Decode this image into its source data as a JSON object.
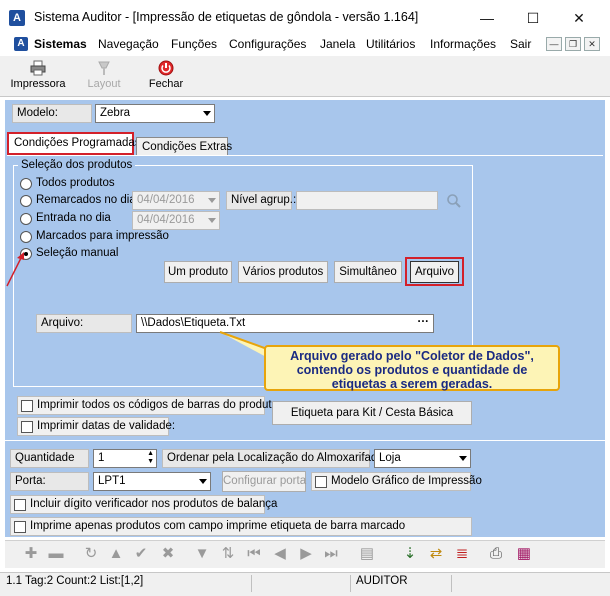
{
  "window": {
    "title": "Sistema Auditor - [Impressão de etiquetas de gôndola - versão 1.164]",
    "app_icon_letter": "A",
    "minimize": "—",
    "maximize": "☐",
    "close": "✕"
  },
  "menu": {
    "items": [
      "Sistemas",
      "Navegação",
      "Funções",
      "Configurações",
      "Janela",
      "Utilitários",
      "Informações",
      "Sair"
    ],
    "mdi_min": "—",
    "mdi_restore": "❐",
    "mdi_close": "✕"
  },
  "toolbar": {
    "impressora": "Impressora",
    "layout": "Layout",
    "fechar": "Fechar"
  },
  "modelo": {
    "label": "Modelo:",
    "value": "Zebra"
  },
  "tabs": [
    "Condições Programadas",
    "Condições Extras"
  ],
  "selecao": {
    "group_title": "Seleção dos produtos",
    "options": [
      "Todos produtos",
      "Remarcados no dia",
      "Entrada no dia",
      "Marcados para impressão",
      "Seleção manual"
    ],
    "selected_index": 4,
    "date1": "04/04/2016",
    "date2": "04/04/2016",
    "nivel_label": "Nível agrup.:"
  },
  "buttons": {
    "um_produto": "Um produto",
    "varios_produtos": "Vários produtos",
    "simultaneo": "Simultâneo",
    "arquivo": "Arquivo",
    "etiqueta_kit": "Etiqueta para Kit / Cesta Básica",
    "configurar_porta": "Configurar porta",
    "ellipsis": "···"
  },
  "arquivo": {
    "label": "Arquivo:",
    "value": "\\\\Dados\\Etiqueta.Txt"
  },
  "callout": {
    "line1": "Arquivo gerado pelo \"Coletor de Dados\",",
    "line2": "contendo os produtos e quantidade de",
    "line3": "etiquetas a serem geradas."
  },
  "checks": {
    "imprimir_codigos": "Imprimir todos os códigos de barras do produto",
    "imprimir_datas": "Imprimir datas de validade:",
    "modelo_grafico": "Modelo Gráfico de Impressão",
    "incluir_digito": "Incluir dígito verificador nos produtos de balança",
    "imprime_apenas": "Imprime apenas produtos com campo imprime etiqueta de barra marcado"
  },
  "quantidade": {
    "label": "Quantidade",
    "value": "1"
  },
  "ordenar": {
    "label": "Ordenar pela Localização do Almoxarifado:",
    "value": "Loja"
  },
  "porta": {
    "label": "Porta:",
    "value": "LPT1"
  },
  "status": {
    "cell1": "1.1 Tag:2 Count:2 List:[1,2]",
    "cell2": "",
    "cell3": "AUDITOR"
  },
  "colors": {
    "panel": "#a8c6ec",
    "highlight": "#d3202a",
    "callout_bg": "#fdf4b6",
    "callout_text": "#1a2a82"
  }
}
